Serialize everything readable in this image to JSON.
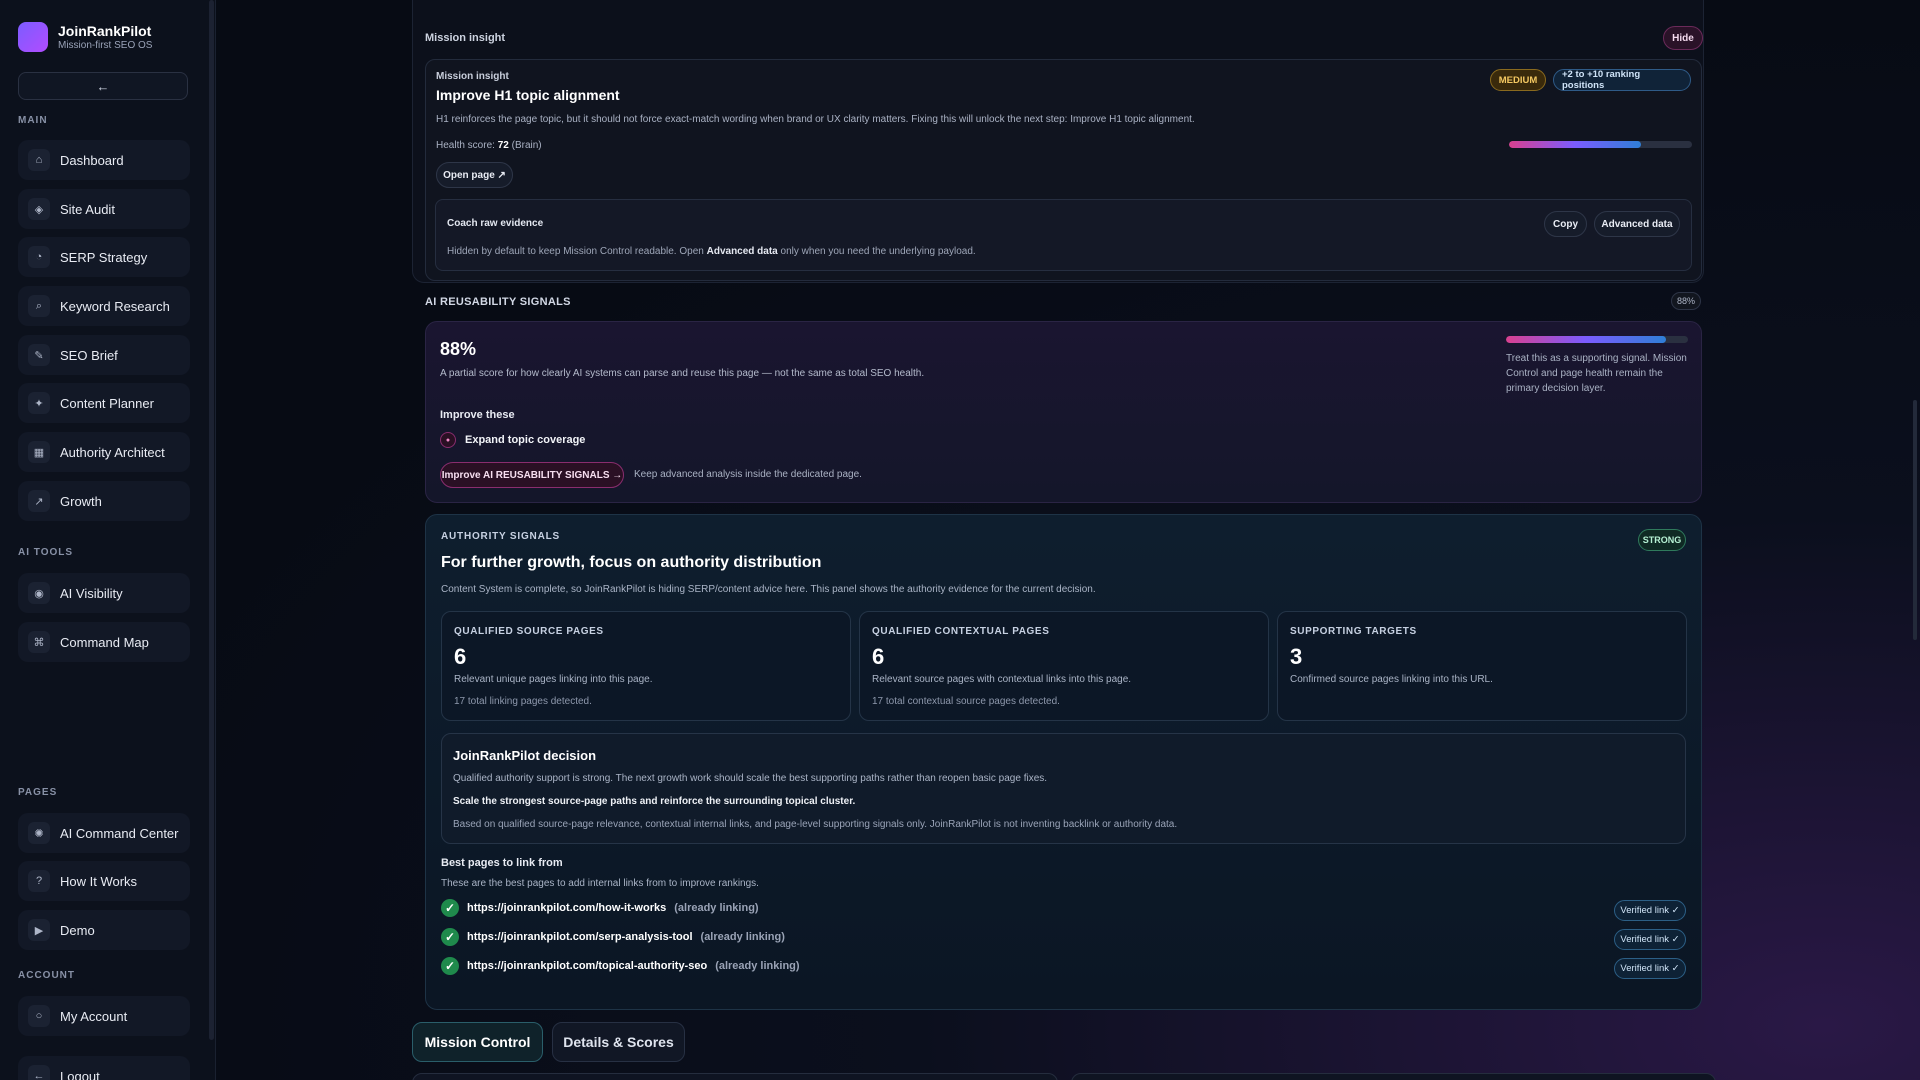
{
  "brand": {
    "name": "JoinRankPilot",
    "tagline": "Mission-first SEO OS"
  },
  "sidebar": {
    "collapse_label": "←",
    "sections": {
      "main": "MAIN",
      "ai_tools": "AI TOOLS",
      "pages": "PAGES",
      "account": "ACCOUNT"
    },
    "main_items": [
      {
        "label": "Dashboard",
        "icon": "home-icon"
      },
      {
        "label": "Site Audit",
        "icon": "audit-icon"
      },
      {
        "label": "SERP Strategy",
        "icon": "strategy-icon"
      },
      {
        "label": "Keyword Research",
        "icon": "search-icon"
      },
      {
        "label": "SEO Brief",
        "icon": "pencil-icon"
      },
      {
        "label": "Content Planner",
        "icon": "sparkle-icon"
      },
      {
        "label": "Authority Architect",
        "icon": "blocks-icon"
      },
      {
        "label": "Growth",
        "icon": "trend-icon"
      }
    ],
    "ai_items": [
      {
        "label": "AI Visibility",
        "icon": "eye-icon"
      },
      {
        "label": "Command Map",
        "icon": "command-icon"
      }
    ],
    "page_items": [
      {
        "label": "AI Command Center",
        "icon": "asterisk-icon"
      },
      {
        "label": "How It Works",
        "icon": "help-icon"
      },
      {
        "label": "Demo",
        "icon": "play-icon"
      }
    ],
    "account_items": [
      {
        "label": "My Account",
        "icon": "user-icon"
      },
      {
        "label": "Logout",
        "icon": "logout-icon"
      }
    ]
  },
  "mission": {
    "header": "Mission insight",
    "hide_label": "Hide",
    "card_label": "Mission insight",
    "title": "Improve H1 topic alignment",
    "priority": "MEDIUM",
    "impact": "+2 to +10 ranking positions",
    "description": "H1 reinforces the page topic, but it should not force exact-match wording when brand or UX clarity matters. Fixing this will unlock the next step: Improve H1 topic alignment.",
    "health_prefix": "Health score:",
    "health_value": "72",
    "health_suffix": "(Brain)",
    "health_fraction": 0.72,
    "open_page": "Open page ↗",
    "coach": {
      "title": "Coach raw evidence",
      "copy": "Copy",
      "advanced": "Advanced data",
      "text_before": "Hidden by default to keep Mission Control readable. Open",
      "text_bold": "Advanced data",
      "text_after": "only when you need the underlying payload."
    }
  },
  "ai": {
    "heading": "AI REUSABILITY SIGNALS",
    "badge": "88%",
    "score": "88%",
    "score_fraction": 0.88,
    "description": "A partial score for how clearly AI systems can parse and reuse this page — not the same as total SEO health.",
    "note": "Treat this as a supporting signal. Mission Control and page health remain the primary decision layer.",
    "improve_title": "Improve these",
    "improve_items": [
      "Expand topic coverage"
    ],
    "button": "Improve AI REUSABILITY SIGNALS →",
    "button_note": "Keep advanced analysis inside the dedicated page."
  },
  "authority": {
    "label": "AUTHORITY SIGNALS",
    "badge": "STRONG",
    "title": "For further growth, focus on authority distribution",
    "subtitle": "Content System is complete, so JoinRankPilot is hiding SERP/content advice here. This panel shows the authority evidence for the current decision.",
    "stats": [
      {
        "heading": "QUALIFIED SOURCE PAGES",
        "value": "6",
        "desc": "Relevant unique pages linking into this page.",
        "extra": "17 total linking pages detected."
      },
      {
        "heading": "QUALIFIED CONTEXTUAL PAGES",
        "value": "6",
        "desc": "Relevant source pages with contextual links into this page.",
        "extra": "17 total contextual source pages detected."
      },
      {
        "heading": "SUPPORTING TARGETS",
        "value": "3",
        "desc": "Confirmed source pages linking into this URL.",
        "extra": ""
      }
    ],
    "decision": {
      "title": "JoinRankPilot decision",
      "text": "Qualified authority support is strong. The next growth work should scale the best supporting paths rather than reopen basic page fixes.",
      "action": "Scale the strongest source-page paths and reinforce the surrounding topical cluster.",
      "footnote": "Based on qualified source-page relevance, contextual internal links, and page-level supporting signals only. JoinRankPilot is not inventing backlink or authority data."
    },
    "best_title": "Best pages to link from",
    "best_sub": "These are the best pages to add internal links from to improve rankings.",
    "links": [
      {
        "url": "https://joinrankpilot.com/how-it-works",
        "status": "(already linking)",
        "badge": "Verified link ✓"
      },
      {
        "url": "https://joinrankpilot.com/serp-analysis-tool",
        "status": "(already linking)",
        "badge": "Verified link ✓"
      },
      {
        "url": "https://joinrankpilot.com/topical-authority-seo",
        "status": "(already linking)",
        "badge": "Verified link ✓"
      }
    ]
  },
  "tabs": [
    {
      "label": "Mission Control"
    },
    {
      "label": "Details & Scores"
    }
  ]
}
